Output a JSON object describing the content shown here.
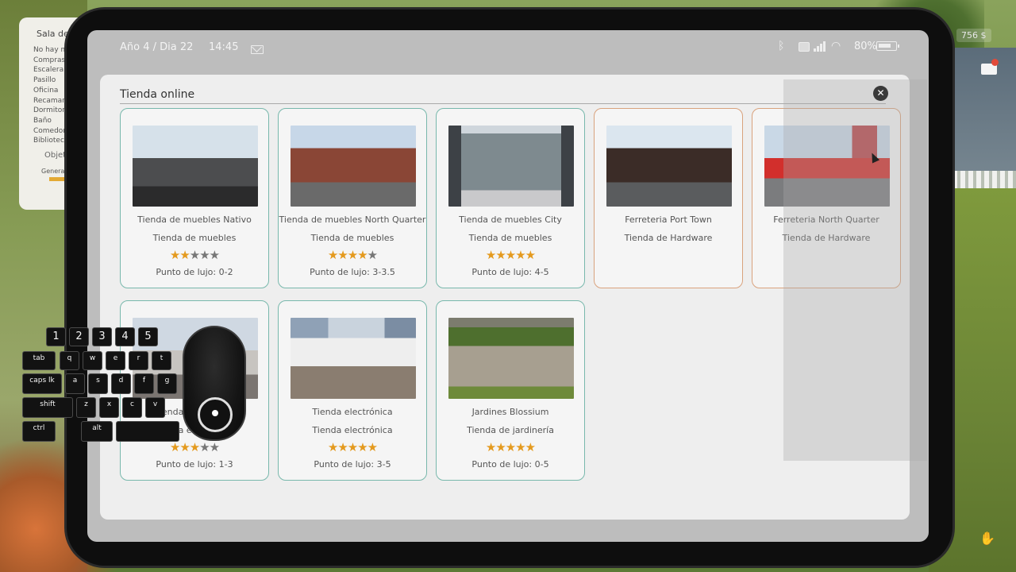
{
  "side_panel": {
    "title": "Sala de",
    "items": [
      "No hay m",
      "Compras",
      "Escalera",
      "Pasillo",
      "Oficina",
      "Recamar",
      "Dormitor",
      "Baño",
      "Comedor",
      "Bibliotec"
    ],
    "objects_label": "Objet",
    "general_label": "Genera"
  },
  "status_bar": {
    "date": "Año 4 / Dia 22",
    "time": "14:45",
    "battery": "80%"
  },
  "money": "756 $",
  "window": {
    "title": "Tienda online",
    "close_icon": "x"
  },
  "stores": [
    {
      "name": "Tienda de muebles Nativo",
      "type": "Tienda de muebles",
      "stars": 2,
      "luxury": "Punto de lujo: 0-2",
      "photo": "p-nativo",
      "accent": "teal"
    },
    {
      "name": "Tienda de muebles North Quarter",
      "type": "Tienda de muebles",
      "stars": 3.5,
      "luxury": "Punto de lujo: 3-3.5",
      "photo": "p-north",
      "accent": "teal"
    },
    {
      "name": "Tienda de muebles City",
      "type": "Tienda de muebles",
      "stars": 5,
      "luxury": "Punto de lujo: 4-5",
      "photo": "p-city",
      "accent": "teal"
    },
    {
      "name": "Ferreteria Port Town",
      "type": "Tienda de Hardware",
      "stars": null,
      "luxury": "",
      "photo": "p-port",
      "accent": "orange"
    },
    {
      "name": "Ferreteria North Quarter",
      "type": "Tienda de Hardware",
      "stars": null,
      "luxury": "",
      "photo": "p-north-hw",
      "accent": "orange"
    },
    {
      "name": "Tienda electrónica",
      "type": "Tienda electrónica",
      "stars": 3,
      "luxury": "Punto de lujo: 1-3",
      "photo": "p-elec1",
      "accent": "teal"
    },
    {
      "name": "Tienda electrónica",
      "type": "Tienda electrónica",
      "stars": 5,
      "luxury": "Punto de lujo: 3-5",
      "photo": "p-elec2",
      "accent": "teal"
    },
    {
      "name": "Jardines Blossium",
      "type": "Tienda de jardinería",
      "stars": 5,
      "luxury": "Punto de lujo: 0-5",
      "photo": "p-garden",
      "accent": "teal"
    }
  ],
  "keyboard_overlay": {
    "numbers": [
      "1",
      "2",
      "3",
      "4",
      "5"
    ],
    "row_q": [
      "tab",
      "q",
      "w",
      "e",
      "r",
      "t"
    ],
    "row_a": [
      "caps lk",
      "a",
      "s",
      "d",
      "f",
      "g"
    ],
    "row_z": [
      "shift",
      "z",
      "x",
      "c",
      "v"
    ],
    "row_ctrl": [
      "ctrl",
      "alt",
      ""
    ]
  }
}
